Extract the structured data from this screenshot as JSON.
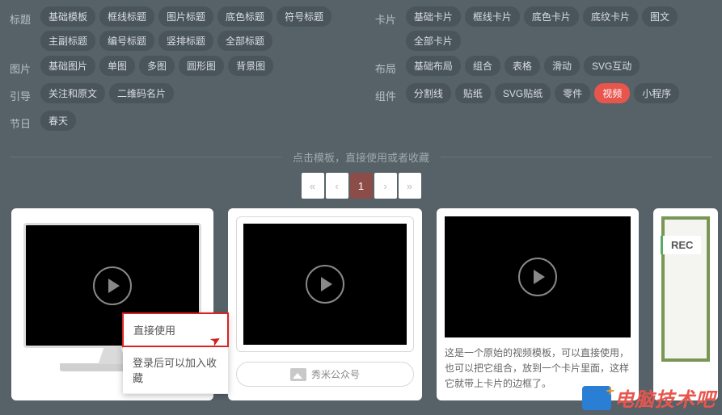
{
  "filters": {
    "left": [
      {
        "label": "标题",
        "tags": [
          "基础模板",
          "框线标题",
          "图片标题",
          "底色标题",
          "符号标题",
          "主副标题",
          "编号标题",
          "竖排标题",
          "全部标题"
        ]
      },
      {
        "label": "图片",
        "tags": [
          "基础图片",
          "单图",
          "多图",
          "圆形图",
          "背景图"
        ]
      },
      {
        "label": "引导",
        "tags": [
          "关注和原文",
          "二维码名片"
        ]
      },
      {
        "label": "节日",
        "tags": [
          "春天"
        ]
      }
    ],
    "right": [
      {
        "label": "卡片",
        "tags": [
          "基础卡片",
          "框线卡片",
          "底色卡片",
          "底纹卡片",
          "图文",
          "全部卡片"
        ]
      },
      {
        "label": "布局",
        "tags": [
          "基础布局",
          "组合",
          "表格",
          "滑动",
          "SVG互动"
        ]
      },
      {
        "label": "组件",
        "tags": [
          "分割线",
          "贴纸",
          "SVG贴纸",
          "零件",
          "视频",
          "小程序"
        ],
        "activeIndex": 4
      }
    ]
  },
  "divider_text": "点击模板，直接使用或者收藏",
  "pagination": {
    "first": "«",
    "prev": "‹",
    "page": "1",
    "next": "›",
    "last": "»"
  },
  "popup": {
    "use_now": "直接使用",
    "login_fav": "登录后可以加入收藏"
  },
  "card2_caption": "秀米公众号",
  "card3_text": "这是一个原始的视频模板，可以直接使用，也可以把它组合，放到一个卡片里面，这样它就带上卡片的边框了。",
  "rec_label": "REC",
  "watermark_text": "电脑技术吧"
}
